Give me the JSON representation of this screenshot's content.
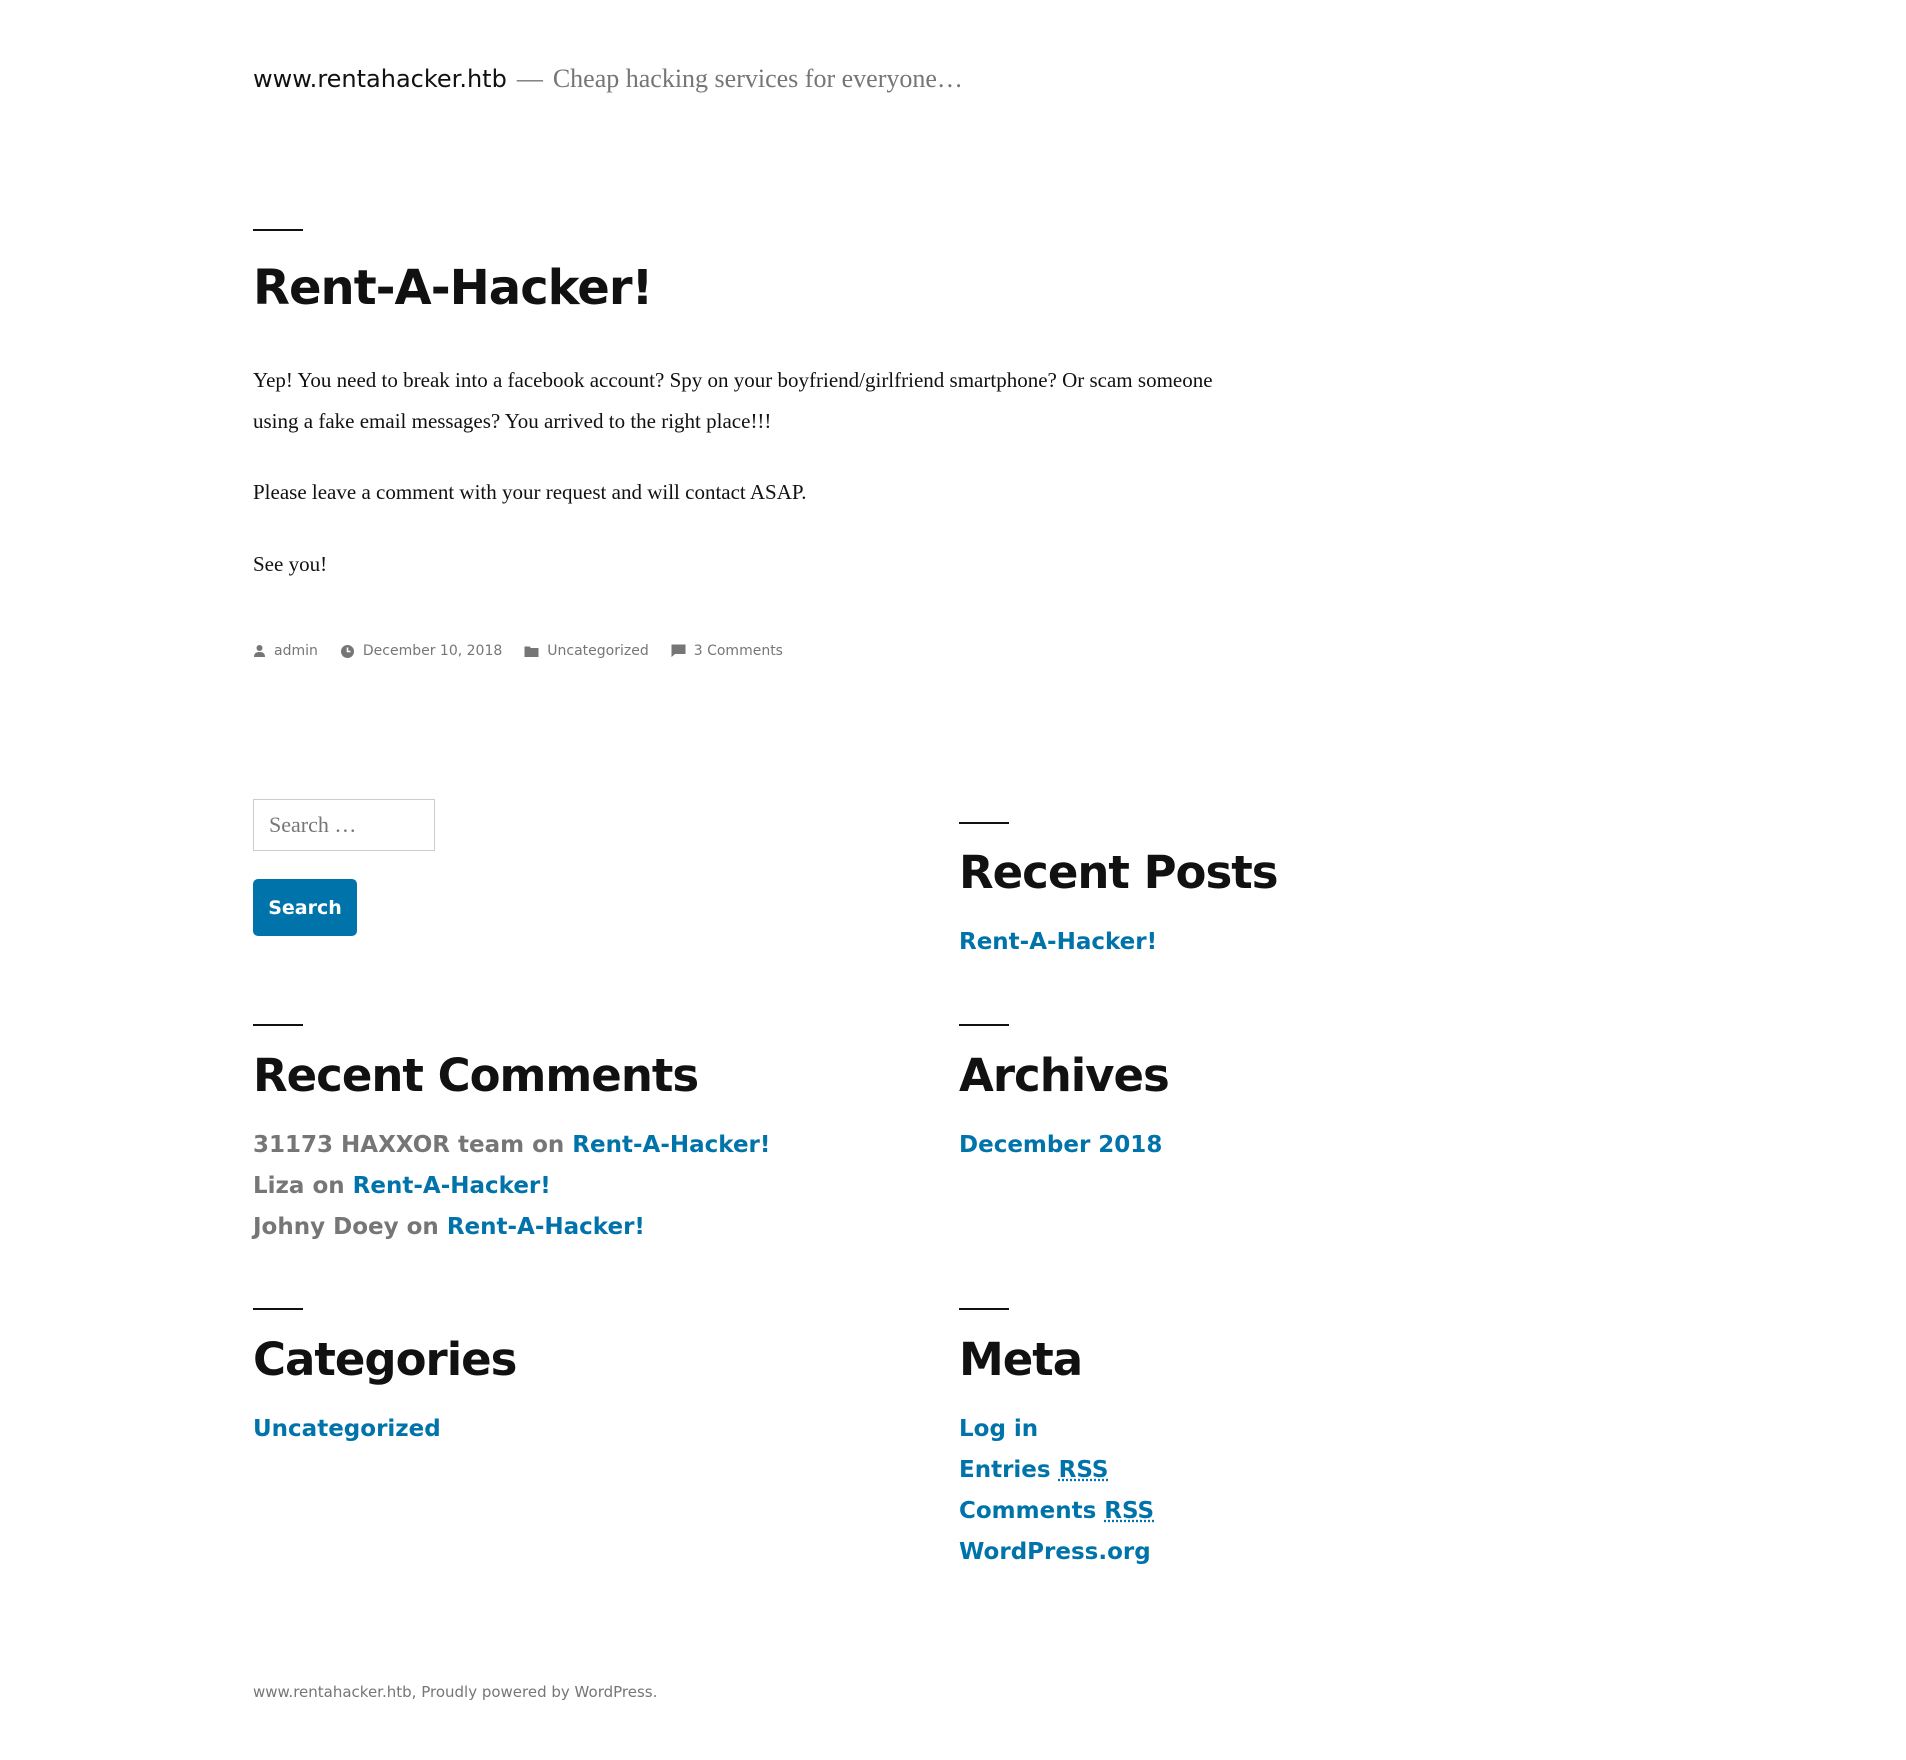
{
  "header": {
    "site_title": "www.rentahacker.htb",
    "separator": "—",
    "description": "Cheap hacking services for everyone…"
  },
  "post": {
    "title": "Rent-A-Hacker!",
    "paragraphs": [
      "Yep! You need to break into a facebook account? Spy on your boyfriend/girlfriend smartphone? Or scam someone using a fake email messages? You arrived to the right place!!!",
      "Please leave a comment with your request and will contact ASAP.",
      "See you!"
    ],
    "meta": {
      "author": "admin",
      "date": "December 10, 2018",
      "category": "Uncategorized",
      "comments": "3 Comments"
    }
  },
  "search": {
    "placeholder": "Search …",
    "button_label": "Search"
  },
  "widgets": {
    "recent_posts": {
      "title": "Recent Posts",
      "items": [
        "Rent-A-Hacker!"
      ]
    },
    "recent_comments": {
      "title": "Recent Comments",
      "connector": "on",
      "items": [
        {
          "author": "31173 HAXXOR team",
          "post": "Rent-A-Hacker!"
        },
        {
          "author": "Liza",
          "post": "Rent-A-Hacker!"
        },
        {
          "author": "Johny Doey",
          "post": "Rent-A-Hacker!"
        }
      ]
    },
    "archives": {
      "title": "Archives",
      "items": [
        "December 2018"
      ]
    },
    "categories": {
      "title": "Categories",
      "items": [
        "Uncategorized"
      ]
    },
    "meta": {
      "title": "Meta",
      "login": "Log in",
      "entries": "Entries",
      "comments": "Comments",
      "rss": "RSS",
      "wordpress": "WordPress.org"
    }
  },
  "footer": {
    "site_link": "www.rentahacker.htb",
    "comma": ",",
    "powered_by": "Proudly powered by WordPress."
  },
  "colors": {
    "link": "#0073aa",
    "muted": "#767676",
    "text": "#111111"
  }
}
